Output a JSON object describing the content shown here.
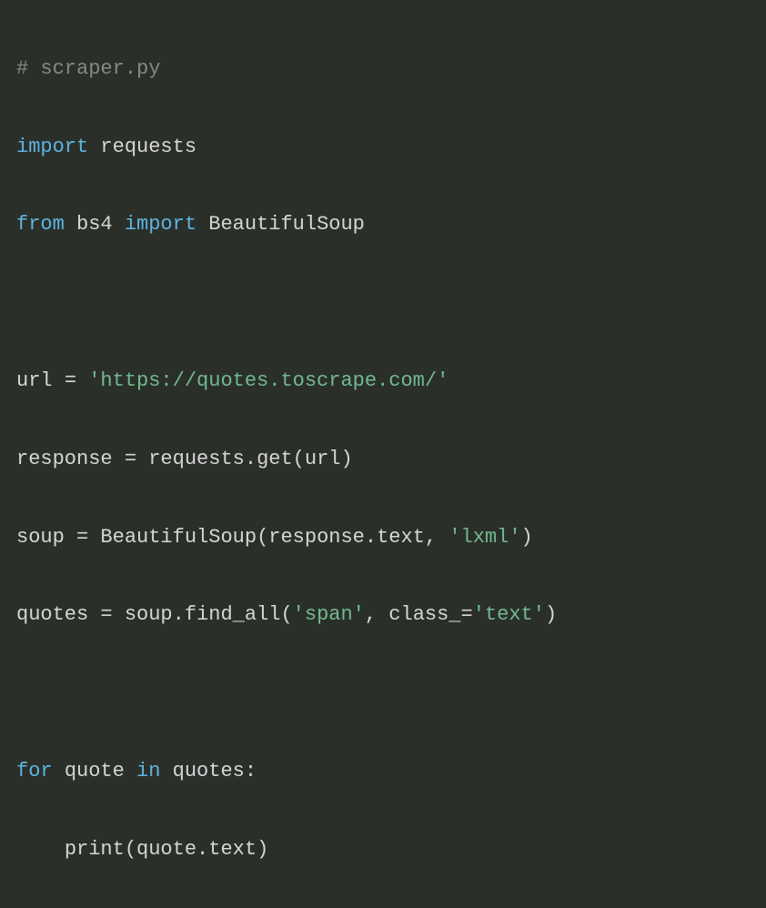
{
  "code": {
    "comment_line": "# scraper.py",
    "l2": {
      "kw_import": "import",
      "mod_requests": "requests"
    },
    "l3": {
      "kw_from": "from",
      "mod_bs4": "bs4",
      "kw_import": "import",
      "cls_bs": "BeautifulSoup"
    },
    "l5": {
      "var_url": "url",
      "op_eq": "=",
      "str_url": "'https://quotes.toscrape.com/'"
    },
    "l6": {
      "var_response": "response",
      "op_eq": "=",
      "mod_requests": "requests",
      "dot1": ".",
      "fn_get": "get",
      "paren_open": "(",
      "arg_url": "url",
      "paren_close": ")"
    },
    "l7": {
      "var_soup": "soup",
      "op_eq": "=",
      "cls_bs": "BeautifulSoup",
      "paren_open": "(",
      "arg_response": "response",
      "dot1": ".",
      "attr_text": "text",
      "comma": ",",
      "str_lxml": "'lxml'",
      "paren_close": ")"
    },
    "l8": {
      "var_quotes": "quotes",
      "op_eq": "=",
      "var_soup": "soup",
      "dot1": ".",
      "fn_findall": "find_all",
      "paren_open": "(",
      "str_span": "'span'",
      "comma": ",",
      "kw_class": "class_",
      "op_eq2": "=",
      "str_text": "'text'",
      "paren_close": ")"
    },
    "l10": {
      "kw_for": "for",
      "var_quote": "quote",
      "kw_in": "in",
      "var_quotes": "quotes",
      "colon": ":"
    },
    "l11": {
      "indent": "    ",
      "fn_print": "print",
      "paren_open": "(",
      "arg_quote": "quote",
      "dot1": ".",
      "attr_text": "text",
      "paren_close": ")"
    }
  }
}
